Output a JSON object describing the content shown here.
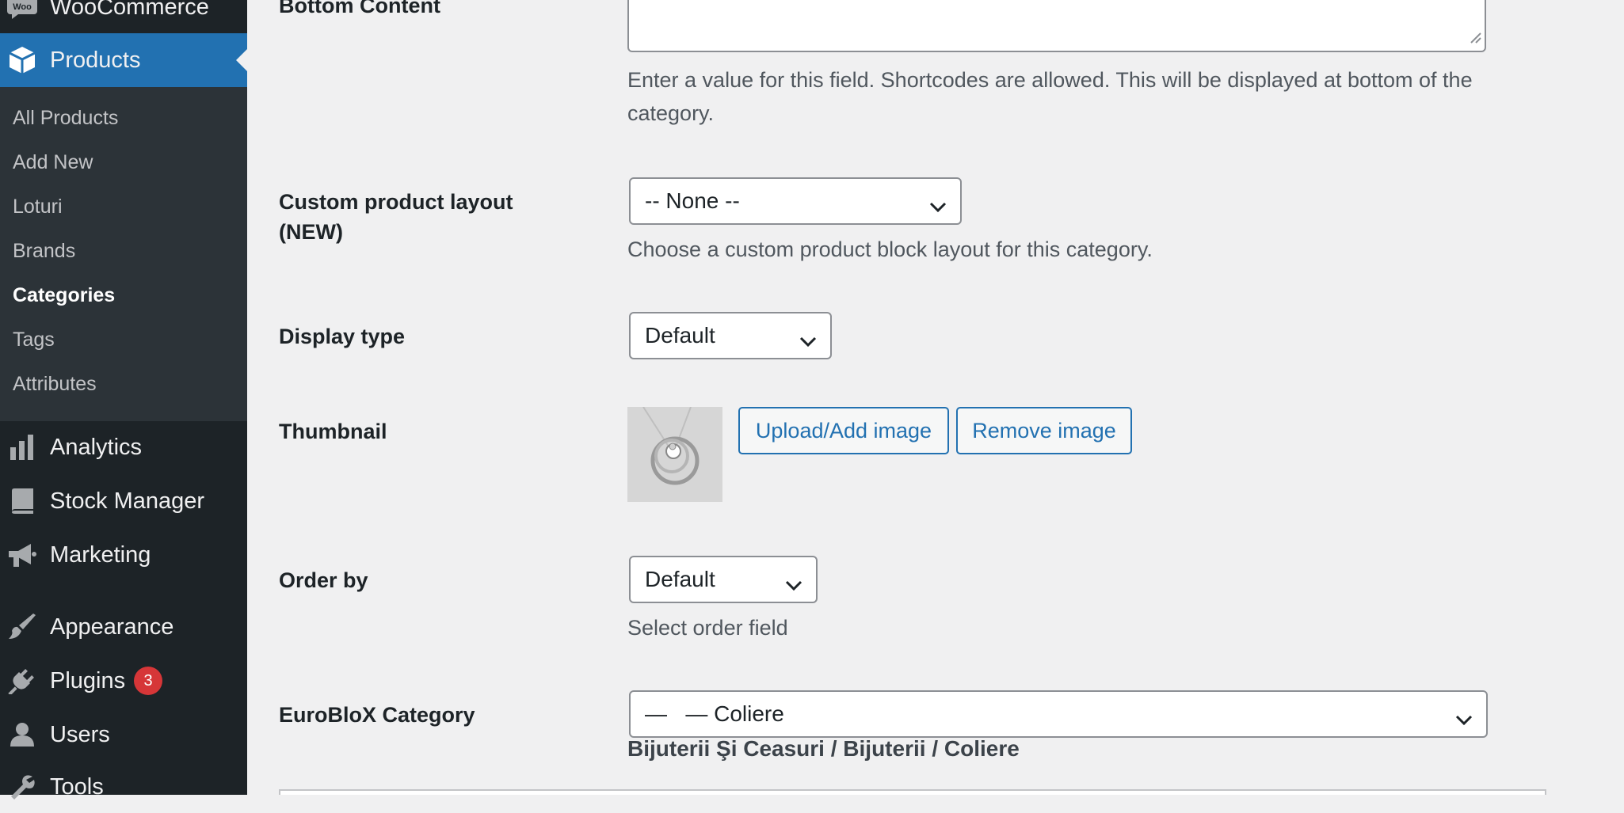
{
  "sidebar": {
    "woocommerce": {
      "label": "WooCommerce",
      "icon": "woo-icon"
    },
    "products": {
      "label": "Products",
      "icon": "box-icon"
    },
    "submenu": [
      {
        "label": "All Products"
      },
      {
        "label": "Add New"
      },
      {
        "label": "Loturi"
      },
      {
        "label": "Brands"
      },
      {
        "label": "Categories"
      },
      {
        "label": "Tags"
      },
      {
        "label": "Attributes"
      }
    ],
    "menu": [
      {
        "label": "Analytics",
        "icon": "bar-chart-icon"
      },
      {
        "label": "Stock Manager",
        "icon": "book-icon"
      },
      {
        "label": "Marketing",
        "icon": "megaphone-icon"
      },
      {
        "label": "Appearance",
        "icon": "brush-icon"
      },
      {
        "label": "Plugins",
        "icon": "plug-icon",
        "badge": "3"
      },
      {
        "label": "Users",
        "icon": "user-icon"
      },
      {
        "label": "Tools",
        "icon": "wrench-icon"
      }
    ]
  },
  "form": {
    "bottom_content": {
      "label": "Bottom Content",
      "value": "",
      "description": "Enter a value for this field. Shortcodes are allowed. This will be displayed at bottom of the category."
    },
    "custom_layout": {
      "label": "Custom product layout (NEW)",
      "selected": "-- None --",
      "description": "Choose a custom product block layout for this category."
    },
    "display_type": {
      "label": "Display type",
      "selected": "Default"
    },
    "thumbnail": {
      "label": "Thumbnail",
      "upload_button": "Upload/Add image",
      "remove_button": "Remove image"
    },
    "order_by": {
      "label": "Order by",
      "selected": "Default",
      "description": "Select order field"
    },
    "euroblox": {
      "label": "EuroBloX Category",
      "selected": "—   — Coliere",
      "path": "Bijuterii Şi Ceasuri / Bijuterii / Coliere"
    }
  },
  "colors": {
    "sidebar_bg": "#1d2327",
    "submenu_bg": "#2c3338",
    "accent": "#2271b1",
    "badge": "#d63638",
    "page_bg": "#f0f0f1"
  }
}
